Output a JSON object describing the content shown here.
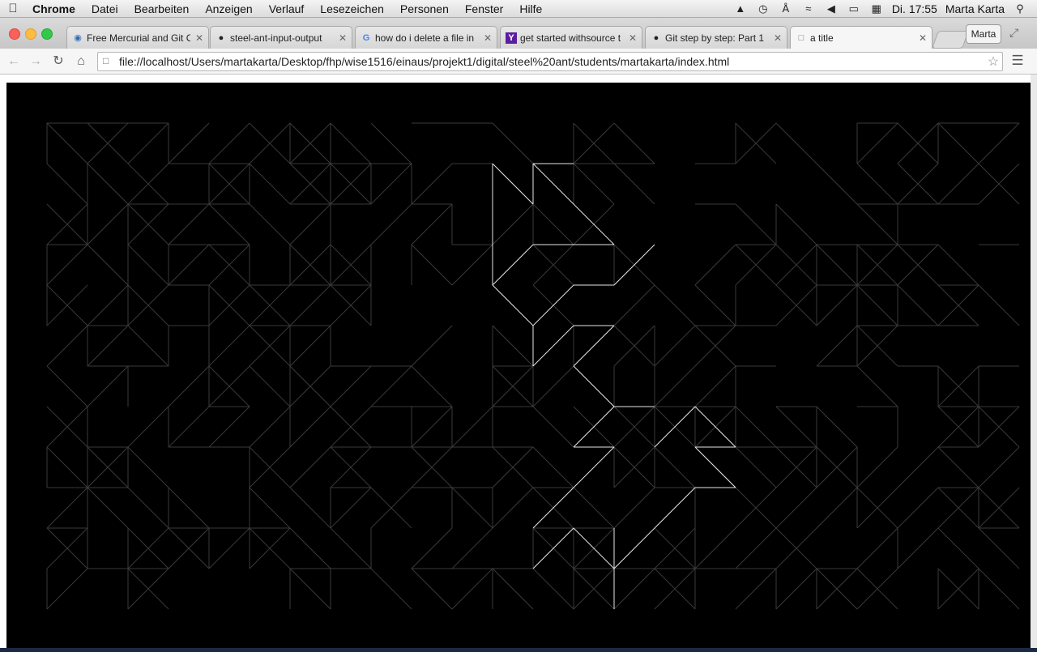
{
  "menubar": {
    "app": "Chrome",
    "items": [
      "Datei",
      "Bearbeiten",
      "Anzeigen",
      "Verlauf",
      "Lesezeichen",
      "Personen",
      "Fenster",
      "Hilfe"
    ],
    "clock": "Di. 17:55",
    "user": "Marta Karta"
  },
  "tabs": [
    {
      "title": "Free Mercurial and Git C",
      "icon": "sourcetree-icon"
    },
    {
      "title": "steel-ant-input-output",
      "icon": "github-icon"
    },
    {
      "title": "how do i delete a file in",
      "icon": "google-icon"
    },
    {
      "title": "get started withsource t",
      "icon": "yahoo-icon"
    },
    {
      "title": "Git step by step: Part 1",
      "icon": "github-icon"
    },
    {
      "title": "a title",
      "icon": "page-icon"
    }
  ],
  "profile": "Marta",
  "address": "file://localhost/Users/martakarta/Desktop/fhp/wise1516/einaus/projekt1/digital/steel%20ant/students/martakarta/index.html",
  "colors": {
    "canvas_bg": "#000000",
    "grid_line": "#3a3a3a",
    "ant_path": "#e6e6e6"
  }
}
